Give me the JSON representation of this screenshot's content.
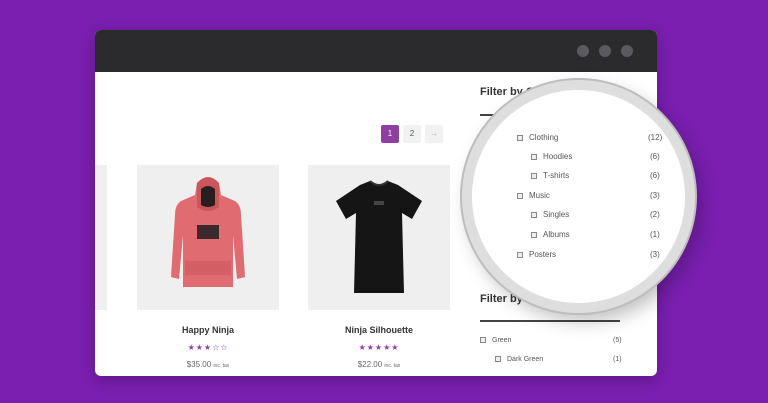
{
  "pagination": {
    "page1": "1",
    "page2": "2",
    "next": "→"
  },
  "products": [
    {
      "name": "Happy Ninja",
      "rating": 3,
      "stars": "★★★☆☆",
      "price": "$35.00",
      "tax": "inc. tax"
    },
    {
      "name": "Ninja Silhouette",
      "rating": 5,
      "stars": "★★★★★",
      "price": "$22.00",
      "tax": "inc. tax"
    }
  ],
  "sidebar": {
    "category_heading": "Filter by Category",
    "color_heading": "Filter by Cushy Color",
    "colors": [
      {
        "label": "Green",
        "count": "(5)"
      },
      {
        "label": "Dark Green",
        "count": "(1)"
      }
    ]
  },
  "magnifier": {
    "categories": [
      {
        "label": "Clothing",
        "count": "(12)"
      },
      {
        "label": "Hoodies",
        "count": "(6)"
      },
      {
        "label": "T-shirts",
        "count": "(6)"
      },
      {
        "label": "Music",
        "count": "(3)"
      },
      {
        "label": "Singles",
        "count": "(2)"
      },
      {
        "label": "Albums",
        "count": "(1)"
      },
      {
        "label": "Posters",
        "count": "(3)"
      }
    ]
  },
  "colors": {
    "background": "#7a1fb0",
    "accent": "#8e3fa0",
    "titlebar": "#2b2b2e"
  }
}
